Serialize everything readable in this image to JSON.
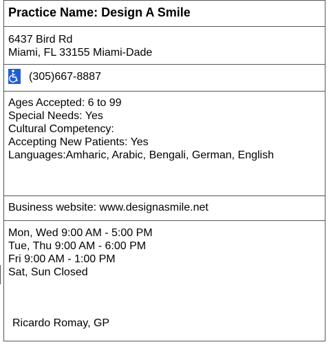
{
  "practice": {
    "title": "Practice Name: Design A Smile",
    "address_line1": "6437 Bird Rd",
    "address_line2": "Miami, FL  33155  Miami-Dade",
    "phone": "(305)667-8887",
    "accessibility_icon": "wheelchair-accessible-icon"
  },
  "details": {
    "ages": "Ages Accepted: 6 to 99",
    "special_needs": "Special Needs: Yes",
    "cultural": "Cultural Competency:",
    "accepting": "Accepting New Patients: Yes",
    "languages": "Languages:Amharic, Arabic, Bengali, German, English"
  },
  "website": "Business website: www.designasmile.net",
  "hours": [
    "Mon, Wed 9:00 AM - 5:00 PM",
    "Tue, Thu 9:00 AM - 6:00 PM",
    "Fri 9:00 AM - 1:00 PM",
    "Sat, Sun Closed"
  ],
  "provider": "Ricardo Romay, GP",
  "colors": {
    "accessibility_icon_bg": "#1f5fd6",
    "border": "#555555"
  }
}
